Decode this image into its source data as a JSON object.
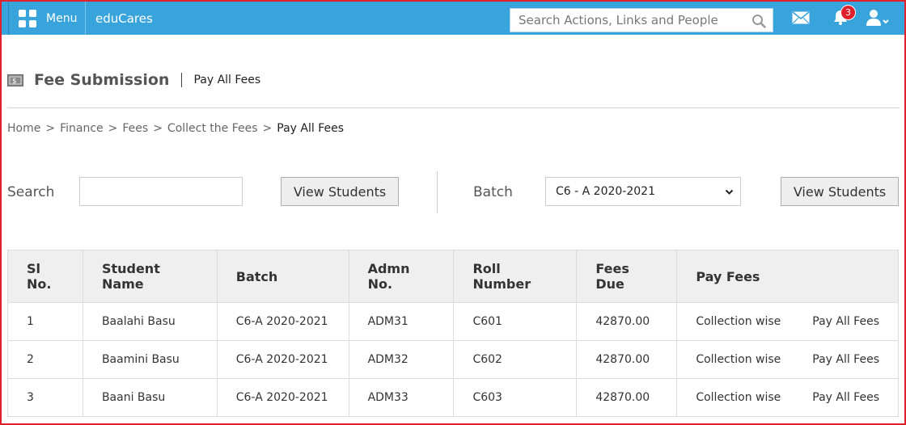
{
  "topbar": {
    "menu_label": "Menu",
    "brand": "eduCares",
    "search_placeholder": "Search Actions, Links and People",
    "notification_count": "3",
    "icons": [
      "apps-grid-icon",
      "search-icon",
      "mail-icon",
      "bell-icon",
      "user-icon"
    ]
  },
  "page": {
    "title": "Fee Submission",
    "subtitle": "Pay All Fees"
  },
  "breadcrumb": {
    "items": [
      "Home",
      "Finance",
      "Fees",
      "Collect the Fees"
    ],
    "current": "Pay All Fees",
    "separator": ">"
  },
  "filters": {
    "search_label": "Search",
    "search_value": "",
    "view_students_label": "View Students",
    "batch_label": "Batch",
    "batch_selected": "C6 - A 2020-2021",
    "view_students_label_2": "View Students"
  },
  "table": {
    "headers": {
      "sl_no": "Sl No.",
      "student_name": "Student Name",
      "batch": "Batch",
      "admn_no": "Admn No.",
      "roll_number": "Roll Number",
      "fees_due": "Fees Due",
      "pay_fees": "Pay Fees"
    },
    "rows": [
      {
        "sl": "1",
        "name": "Baalahi Basu",
        "batch": "C6-A 2020-2021",
        "admn": "ADM31",
        "roll": "C601",
        "due": "42870.00",
        "collection": "Collection wise",
        "pay_all": "Pay All Fees"
      },
      {
        "sl": "2",
        "name": "Baamini Basu",
        "batch": "C6-A 2020-2021",
        "admn": "ADM32",
        "roll": "C602",
        "due": "42870.00",
        "collection": "Collection wise",
        "pay_all": "Pay All Fees"
      },
      {
        "sl": "3",
        "name": "Baani Basu",
        "batch": "C6-A 2020-2021",
        "admn": "ADM33",
        "roll": "C603",
        "due": "42870.00",
        "collection": "Collection wise",
        "pay_all": "Pay All Fees"
      }
    ]
  },
  "colors": {
    "topbar": "#39a3dc",
    "frame_border": "#e0202a",
    "badge": "#e0202a"
  }
}
